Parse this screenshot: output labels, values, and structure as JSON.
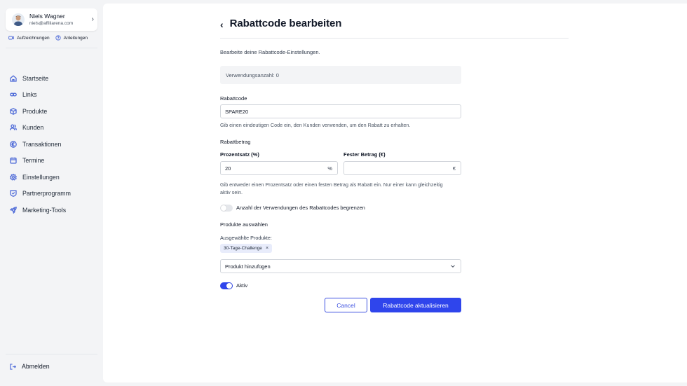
{
  "sidebar": {
    "user": {
      "name": "Niels Wagner",
      "email": "niels@affiliarena.com"
    },
    "quick_links": [
      {
        "label": "Aufzeichnungen",
        "icon": "video-icon"
      },
      {
        "label": "Anleitungen",
        "icon": "help-circle-icon"
      }
    ],
    "nav": [
      {
        "label": "Startseite",
        "icon": "home-icon"
      },
      {
        "label": "Links",
        "icon": "link-icon"
      },
      {
        "label": "Produkte",
        "icon": "box-icon"
      },
      {
        "label": "Kunden",
        "icon": "users-icon"
      },
      {
        "label": "Transaktionen",
        "icon": "euro-icon"
      },
      {
        "label": "Termine",
        "icon": "calendar-icon"
      },
      {
        "label": "Einstellungen",
        "icon": "gear-icon"
      },
      {
        "label": "Partnerprogramm",
        "icon": "badge-icon"
      },
      {
        "label": "Marketing-Tools",
        "icon": "rocket-icon"
      }
    ],
    "logout": "Abmelden"
  },
  "page": {
    "back": "‹",
    "title": "Rabattcode bearbeiten",
    "subtitle": "Bearbeite deine Rabattcode-Einstellungen.",
    "usage": "Verwendungsanzahl: 0"
  },
  "form": {
    "code_label": "Rabattcode",
    "code_value": "SPARE20",
    "code_help": "Gib einen eindeutigen Code ein, den Kunden verwenden, um den Rabatt zu erhalten.",
    "discount_label": "Rabattbetrag",
    "percent_label": "Prozentsatz (%)",
    "percent_value": "20",
    "percent_suffix": "%",
    "fixed_label": "Fester Betrag (€)",
    "fixed_value": "",
    "fixed_suffix": "€",
    "discount_help_1": "Gib entweder einen Prozentsatz oder einen festen Betrag als Rabatt ein. Nur einer kann gleichzeitig",
    "discount_help_2": "aktiv sein.",
    "limit_toggle_label": "Anzahl der Verwendungen des Rabattcodes begrenzen",
    "limit_toggle_on": false,
    "products_label": "Produkte auswählen",
    "selected_products_label": "Ausgewählte Produkte:",
    "selected_products": [
      "30-Tage-Challenge"
    ],
    "add_product_placeholder": "Produkt hinzufügen",
    "active_label": "Aktiv",
    "active_on": true,
    "cancel": "Cancel",
    "submit": "Rabattcode aktualisieren"
  },
  "colors": {
    "accent": "#2f45ec",
    "nav_icon": "#4f6bd8",
    "tag_bg": "#e8ecfb",
    "toggle_off": "#e5e7eb"
  }
}
